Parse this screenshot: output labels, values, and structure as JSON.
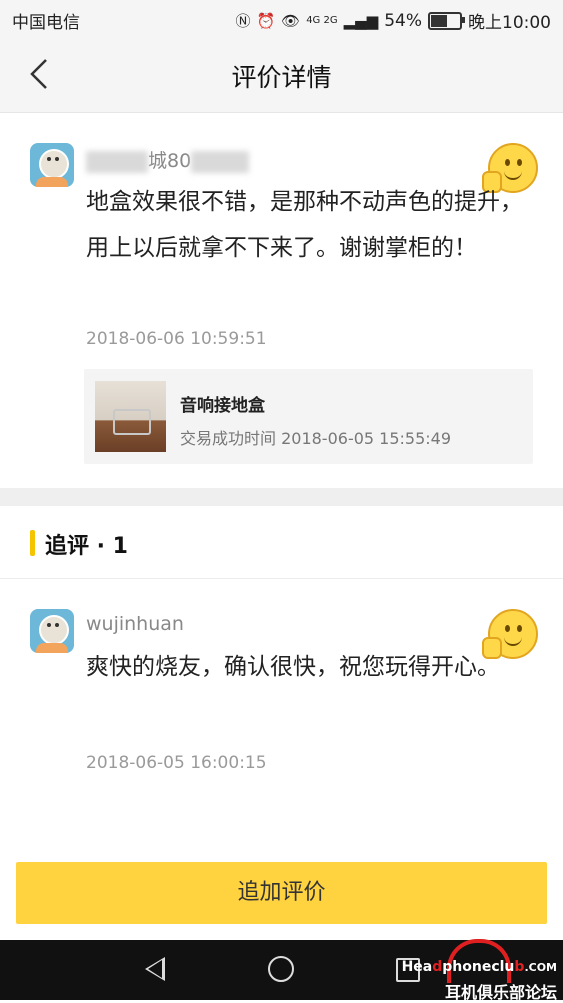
{
  "status_bar": {
    "carrier": "中国电信",
    "network": "4G 2G",
    "battery_text": "54%",
    "battery_level": 0.54,
    "time": "晚上10:00"
  },
  "header": {
    "title": "评价详情"
  },
  "review": {
    "username_visible": "城80",
    "content": "地盒效果很不错，是那种不动声色的提升，用上以后就拿不下来了。谢谢掌柜的！",
    "timestamp": "2018-06-06 10:59:51",
    "order": {
      "title": "音响接地盒",
      "subtitle": "交易成功时间 2018-06-05 15:55:49"
    }
  },
  "followup_section": {
    "heading": "追评 · 1"
  },
  "followup": {
    "username": "wujinhuan",
    "content": "爽快的烧友，确认很快，祝您玩得开心。",
    "timestamp": "2018-06-05 16:00:15"
  },
  "actions": {
    "add_review_label": "追加评价"
  },
  "watermark": {
    "line1_a": "Hea",
    "line1_b": "d",
    "line1_c": "phoneclu",
    "line1_d": "b",
    "line1_e": ".COM",
    "line2": "耳机俱乐部论坛"
  },
  "colors": {
    "accent_yellow": "#ffd23f",
    "section_bar": "#f5c400"
  }
}
